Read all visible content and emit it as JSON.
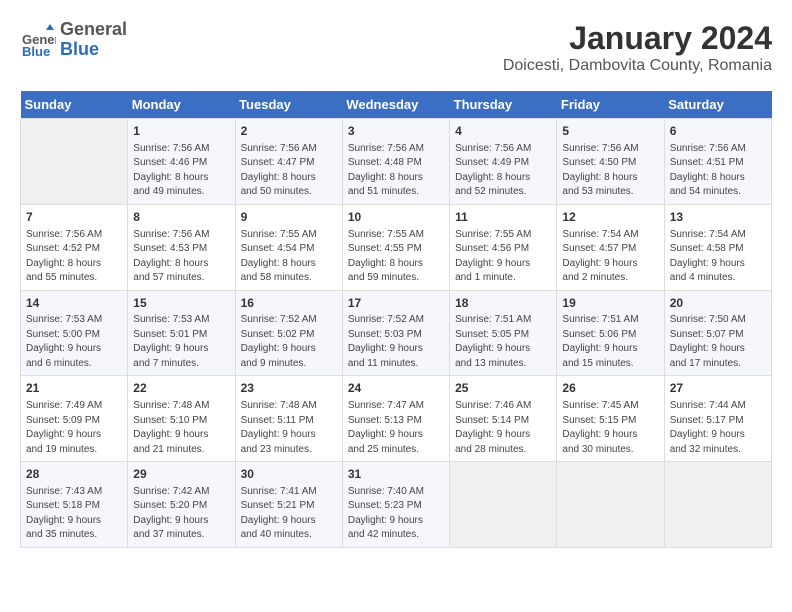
{
  "header": {
    "logo": {
      "line1": "General",
      "line2": "Blue"
    },
    "title": "January 2024",
    "subtitle": "Doicesti, Dambovita County, Romania"
  },
  "days_of_week": [
    "Sunday",
    "Monday",
    "Tuesday",
    "Wednesday",
    "Thursday",
    "Friday",
    "Saturday"
  ],
  "weeks": [
    [
      {
        "day": "",
        "info": ""
      },
      {
        "day": "1",
        "info": "Sunrise: 7:56 AM\nSunset: 4:46 PM\nDaylight: 8 hours\nand 49 minutes."
      },
      {
        "day": "2",
        "info": "Sunrise: 7:56 AM\nSunset: 4:47 PM\nDaylight: 8 hours\nand 50 minutes."
      },
      {
        "day": "3",
        "info": "Sunrise: 7:56 AM\nSunset: 4:48 PM\nDaylight: 8 hours\nand 51 minutes."
      },
      {
        "day": "4",
        "info": "Sunrise: 7:56 AM\nSunset: 4:49 PM\nDaylight: 8 hours\nand 52 minutes."
      },
      {
        "day": "5",
        "info": "Sunrise: 7:56 AM\nSunset: 4:50 PM\nDaylight: 8 hours\nand 53 minutes."
      },
      {
        "day": "6",
        "info": "Sunrise: 7:56 AM\nSunset: 4:51 PM\nDaylight: 8 hours\nand 54 minutes."
      }
    ],
    [
      {
        "day": "7",
        "info": "Sunrise: 7:56 AM\nSunset: 4:52 PM\nDaylight: 8 hours\nand 55 minutes."
      },
      {
        "day": "8",
        "info": "Sunrise: 7:56 AM\nSunset: 4:53 PM\nDaylight: 8 hours\nand 57 minutes."
      },
      {
        "day": "9",
        "info": "Sunrise: 7:55 AM\nSunset: 4:54 PM\nDaylight: 8 hours\nand 58 minutes."
      },
      {
        "day": "10",
        "info": "Sunrise: 7:55 AM\nSunset: 4:55 PM\nDaylight: 8 hours\nand 59 minutes."
      },
      {
        "day": "11",
        "info": "Sunrise: 7:55 AM\nSunset: 4:56 PM\nDaylight: 9 hours\nand 1 minute."
      },
      {
        "day": "12",
        "info": "Sunrise: 7:54 AM\nSunset: 4:57 PM\nDaylight: 9 hours\nand 2 minutes."
      },
      {
        "day": "13",
        "info": "Sunrise: 7:54 AM\nSunset: 4:58 PM\nDaylight: 9 hours\nand 4 minutes."
      }
    ],
    [
      {
        "day": "14",
        "info": "Sunrise: 7:53 AM\nSunset: 5:00 PM\nDaylight: 9 hours\nand 6 minutes."
      },
      {
        "day": "15",
        "info": "Sunrise: 7:53 AM\nSunset: 5:01 PM\nDaylight: 9 hours\nand 7 minutes."
      },
      {
        "day": "16",
        "info": "Sunrise: 7:52 AM\nSunset: 5:02 PM\nDaylight: 9 hours\nand 9 minutes."
      },
      {
        "day": "17",
        "info": "Sunrise: 7:52 AM\nSunset: 5:03 PM\nDaylight: 9 hours\nand 11 minutes."
      },
      {
        "day": "18",
        "info": "Sunrise: 7:51 AM\nSunset: 5:05 PM\nDaylight: 9 hours\nand 13 minutes."
      },
      {
        "day": "19",
        "info": "Sunrise: 7:51 AM\nSunset: 5:06 PM\nDaylight: 9 hours\nand 15 minutes."
      },
      {
        "day": "20",
        "info": "Sunrise: 7:50 AM\nSunset: 5:07 PM\nDaylight: 9 hours\nand 17 minutes."
      }
    ],
    [
      {
        "day": "21",
        "info": "Sunrise: 7:49 AM\nSunset: 5:09 PM\nDaylight: 9 hours\nand 19 minutes."
      },
      {
        "day": "22",
        "info": "Sunrise: 7:48 AM\nSunset: 5:10 PM\nDaylight: 9 hours\nand 21 minutes."
      },
      {
        "day": "23",
        "info": "Sunrise: 7:48 AM\nSunset: 5:11 PM\nDaylight: 9 hours\nand 23 minutes."
      },
      {
        "day": "24",
        "info": "Sunrise: 7:47 AM\nSunset: 5:13 PM\nDaylight: 9 hours\nand 25 minutes."
      },
      {
        "day": "25",
        "info": "Sunrise: 7:46 AM\nSunset: 5:14 PM\nDaylight: 9 hours\nand 28 minutes."
      },
      {
        "day": "26",
        "info": "Sunrise: 7:45 AM\nSunset: 5:15 PM\nDaylight: 9 hours\nand 30 minutes."
      },
      {
        "day": "27",
        "info": "Sunrise: 7:44 AM\nSunset: 5:17 PM\nDaylight: 9 hours\nand 32 minutes."
      }
    ],
    [
      {
        "day": "28",
        "info": "Sunrise: 7:43 AM\nSunset: 5:18 PM\nDaylight: 9 hours\nand 35 minutes."
      },
      {
        "day": "29",
        "info": "Sunrise: 7:42 AM\nSunset: 5:20 PM\nDaylight: 9 hours\nand 37 minutes."
      },
      {
        "day": "30",
        "info": "Sunrise: 7:41 AM\nSunset: 5:21 PM\nDaylight: 9 hours\nand 40 minutes."
      },
      {
        "day": "31",
        "info": "Sunrise: 7:40 AM\nSunset: 5:23 PM\nDaylight: 9 hours\nand 42 minutes."
      },
      {
        "day": "",
        "info": ""
      },
      {
        "day": "",
        "info": ""
      },
      {
        "day": "",
        "info": ""
      }
    ]
  ]
}
